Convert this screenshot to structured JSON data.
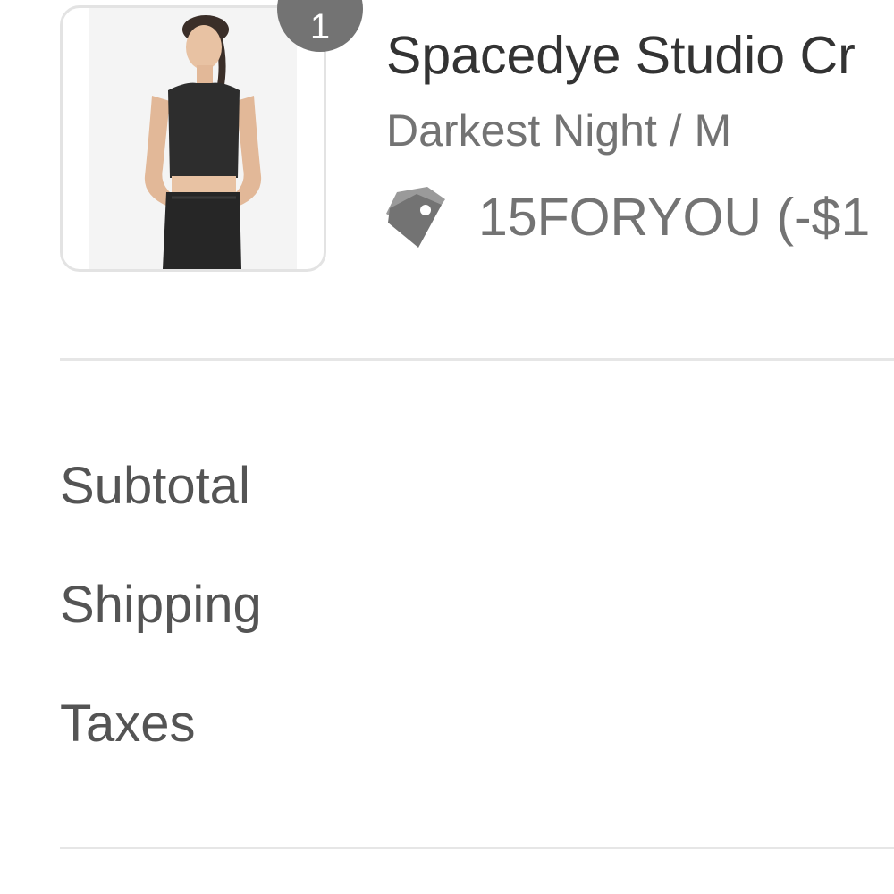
{
  "line_item": {
    "quantity": "1",
    "title": "Spacedye Studio Cr",
    "variant": "Darkest Night / M",
    "discount_icon": "tag-icon",
    "discount": "15FORYOU (-$1",
    "image": "product-photo-black-crop-top-and-leggings"
  },
  "summary": {
    "subtotal_label": "Subtotal",
    "shipping_label": "Shipping",
    "taxes_label": "Taxes"
  },
  "colors": {
    "badge": "#737373",
    "text_primary": "#333333",
    "text_secondary": "#737373",
    "divider": "#e6e6e6"
  }
}
